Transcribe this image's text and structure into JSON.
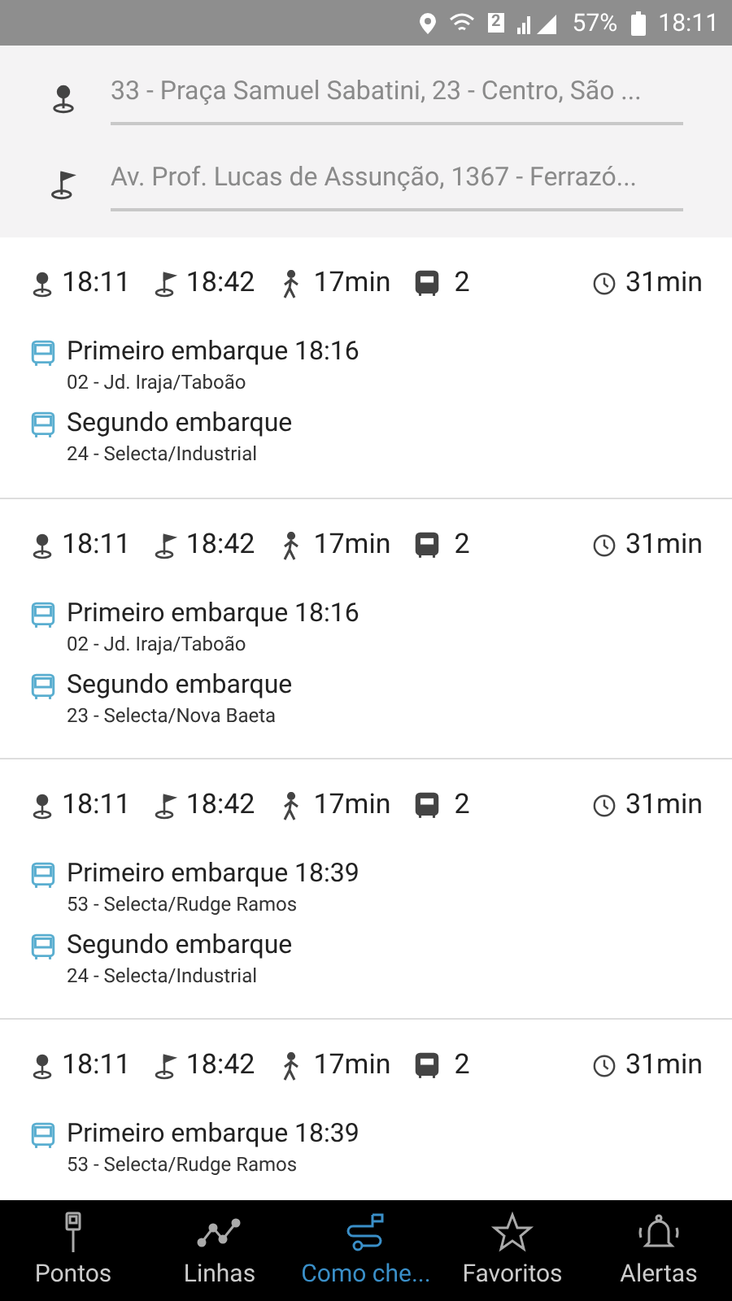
{
  "status_bar": {
    "battery": "57%",
    "time": "18:11",
    "sim_badge": "2"
  },
  "origin": {
    "value": "33 - Praça Samuel Sabatini, 23 - Centro, São ..."
  },
  "destination": {
    "value": "Av. Prof. Lucas de Assunção, 1367 - Ferrazó..."
  },
  "trips": [
    {
      "depart": "18:11",
      "arrive": "18:42",
      "walk": "17min",
      "buses": "2",
      "duration": "31min",
      "legs": [
        {
          "title": "Primeiro embarque",
          "time": "18:16",
          "route": "02 - Jd. Iraja/Taboão"
        },
        {
          "title": "Segundo embarque",
          "route": "24 - Selecta/Industrial"
        }
      ]
    },
    {
      "depart": "18:11",
      "arrive": "18:42",
      "walk": "17min",
      "buses": "2",
      "duration": "31min",
      "legs": [
        {
          "title": "Primeiro embarque",
          "time": "18:16",
          "route": "02 - Jd. Iraja/Taboão"
        },
        {
          "title": "Segundo embarque",
          "route": "23 - Selecta/Nova Baeta"
        }
      ]
    },
    {
      "depart": "18:11",
      "arrive": "18:42",
      "walk": "17min",
      "buses": "2",
      "duration": "31min",
      "legs": [
        {
          "title": "Primeiro embarque",
          "time": "18:39",
          "route": "53 - Selecta/Rudge Ramos"
        },
        {
          "title": "Segundo embarque",
          "route": "24 - Selecta/Industrial"
        }
      ]
    },
    {
      "depart": "18:11",
      "arrive": "18:42",
      "walk": "17min",
      "buses": "2",
      "duration": "31min",
      "legs": [
        {
          "title": "Primeiro embarque",
          "time": "18:39",
          "route": "53 - Selecta/Rudge Ramos"
        }
      ]
    }
  ],
  "nav": [
    {
      "label": "Pontos",
      "kind": "stop",
      "selected": false
    },
    {
      "label": "Linhas",
      "kind": "lines",
      "selected": false
    },
    {
      "label": "Como che...",
      "kind": "route",
      "selected": true
    },
    {
      "label": "Favoritos",
      "kind": "star",
      "selected": false
    },
    {
      "label": "Alertas",
      "kind": "bell",
      "selected": false
    }
  ]
}
